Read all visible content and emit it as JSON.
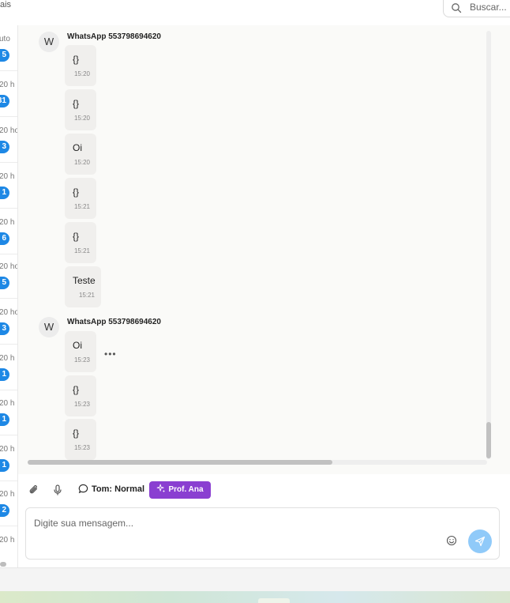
{
  "topbar": {
    "left_label": "ais",
    "search_placeholder": "Buscar..."
  },
  "conversations": [
    {
      "time": "uto",
      "badge": "5"
    },
    {
      "time": "20 h",
      "badge": "31"
    },
    {
      "time": "20 ho",
      "badge": "3"
    },
    {
      "time": "20 h",
      "badge": "1"
    },
    {
      "time": "20 h",
      "badge": "6"
    },
    {
      "time": "20 ho",
      "badge": "5"
    },
    {
      "time": "20 ho",
      "badge": "3"
    },
    {
      "time": "20 h",
      "badge": "1"
    },
    {
      "time": "20 h",
      "badge": "1"
    },
    {
      "time": "20 h",
      "badge": "1"
    },
    {
      "time": "20 h",
      "badge": "2"
    },
    {
      "time": "20 h",
      "badge": ""
    }
  ],
  "chat": {
    "groups": [
      {
        "avatar": "W",
        "sender": "WhatsApp 553798694620",
        "messages": [
          {
            "text": "{}",
            "time": "15:20"
          },
          {
            "text": "{}",
            "time": "15:20"
          },
          {
            "text": "Oi",
            "time": "15:20"
          },
          {
            "text": "{}",
            "time": "15:21"
          },
          {
            "text": "{}",
            "time": "15:21"
          },
          {
            "text": "Teste",
            "time": "15:21"
          }
        ]
      },
      {
        "avatar": "W",
        "sender": "WhatsApp 553798694620",
        "more": "•••",
        "messages": [
          {
            "text": "Oi",
            "time": "15:23"
          },
          {
            "text": "{}",
            "time": "15:23"
          },
          {
            "text": "{}",
            "time": "15:23"
          }
        ]
      }
    ]
  },
  "toolbar": {
    "attach_icon": "paperclip-icon",
    "mic_icon": "microphone-icon",
    "tone_label": "Tom: Normal",
    "prof_label": "Prof. Ana"
  },
  "composer": {
    "placeholder": "Digite sua mensagem...",
    "emoji_icon": "smiley-icon",
    "send_icon": "send-icon"
  },
  "colors": {
    "badge": "#1e88e5",
    "prof_button": "#8a3fd1",
    "send_button": "#90caf9",
    "chat_bg": "#fafaf8",
    "bubble_bg": "#f0efed"
  }
}
